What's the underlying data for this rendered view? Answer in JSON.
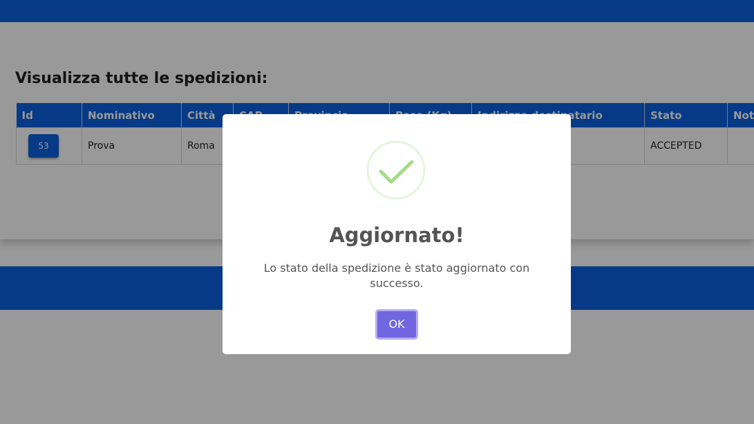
{
  "page": {
    "title": "Visualizza tutte le spedizioni:"
  },
  "table": {
    "columns": [
      "Id",
      "Nominativo",
      "Città",
      "CAP",
      "Provincia",
      "Peso (Kg)",
      "Indirizzo destinatario",
      "Stato",
      "Note"
    ],
    "rows": [
      {
        "id": "53",
        "nominativo": "Prova",
        "citta": "Roma",
        "cap": "",
        "provincia": "",
        "peso": "",
        "indirizzo": "",
        "stato": "ACCEPTED",
        "note": ""
      }
    ]
  },
  "modal": {
    "icon": "checkmark-success-icon",
    "title": "Aggiornato!",
    "message": "Lo stato della spedizione è stato aggiornato con successo.",
    "ok_label": "OK"
  },
  "colors": {
    "primary_blue": "#0a62e0",
    "confirm_button": "#7066e0",
    "success_green": "#a5dc86"
  }
}
